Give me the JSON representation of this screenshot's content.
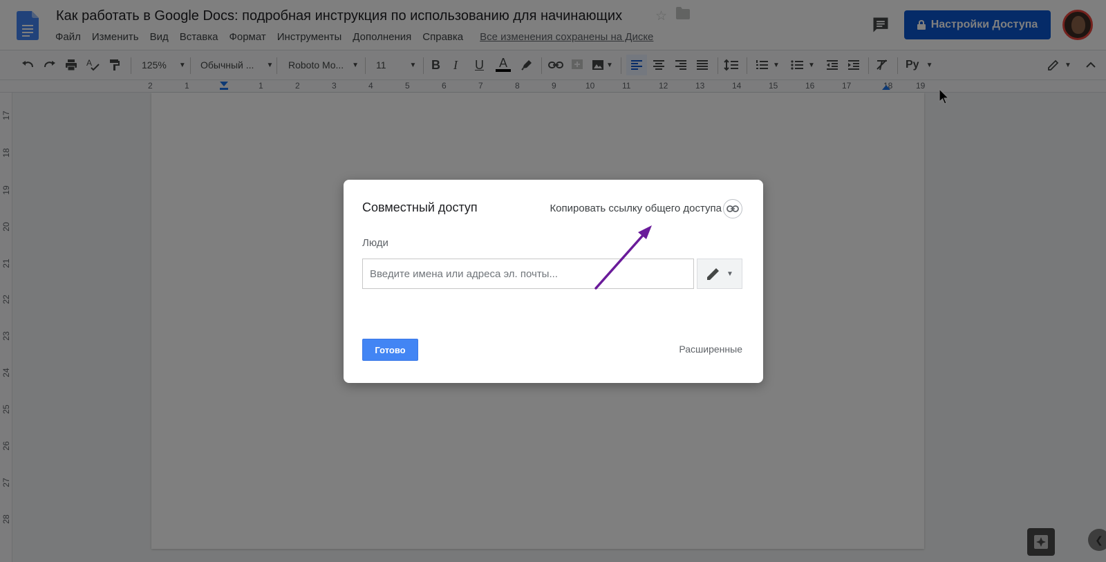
{
  "header": {
    "doc_title": "Как работать в Google Docs: подробная инструкция по использованию для начинающих",
    "share_label": "Настройки Доступа",
    "saved_status": "Все изменения сохранены на Диске",
    "menu": [
      "Файл",
      "Изменить",
      "Вид",
      "Вставка",
      "Формат",
      "Инструменты",
      "Дополнения",
      "Справка"
    ]
  },
  "toolbar": {
    "zoom": "125%",
    "style": "Обычный ...",
    "font": "Roboto Mo...",
    "size": "11",
    "language": "Ру"
  },
  "ruler": {
    "h_labels": [
      "2",
      "1",
      "1",
      "2",
      "3",
      "4",
      "5",
      "6",
      "7",
      "8",
      "9",
      "10",
      "11",
      "12",
      "13",
      "14",
      "15",
      "16",
      "17",
      "18",
      "19"
    ],
    "v_labels": [
      "17",
      "18",
      "19",
      "20",
      "21",
      "22",
      "23",
      "24",
      "25",
      "26",
      "27",
      "28"
    ]
  },
  "dialog": {
    "title": "Совместный доступ",
    "copy_link": "Копировать ссылку общего доступа",
    "people_label": "Люди",
    "people_placeholder": "Введите имена или адреса эл. почты...",
    "done_label": "Готово",
    "advanced_label": "Расширенные"
  },
  "colors": {
    "share_button": "#0b57d0",
    "done_button": "#4285f4",
    "annotation_arrow": "#6a1b9a"
  }
}
